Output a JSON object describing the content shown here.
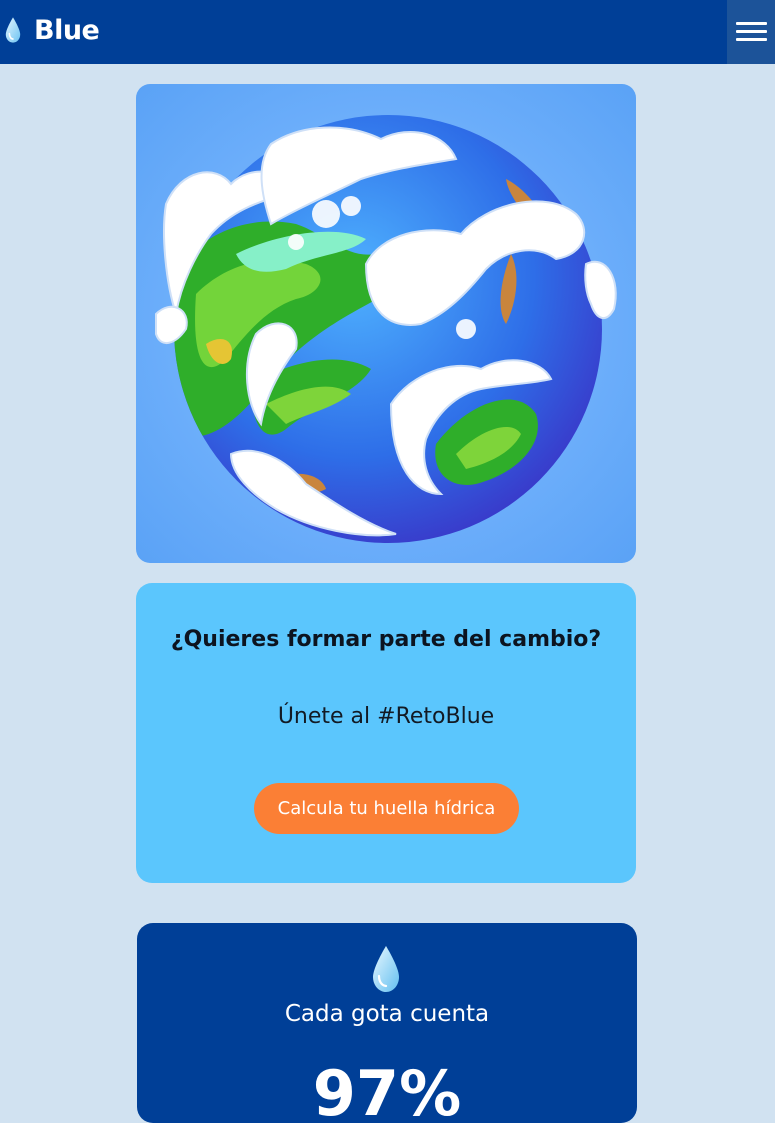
{
  "navbar": {
    "brand": "Blue",
    "logo_icon": "water-drop-icon",
    "menu_icon": "hamburger-menu-icon"
  },
  "hero": {
    "image": "cartoon-earth-globe-illustration"
  },
  "cta": {
    "title": "¿Quieres formar parte del cambio?",
    "subtitle": "Únete al #RetoBlue",
    "button": "Calcula tu huella hídrica"
  },
  "stat": {
    "icon": "water-drop-icon",
    "caption": "Cada gota cuenta",
    "value": "97%"
  },
  "colors": {
    "navbar": "#003f97",
    "background": "#d1e2f1",
    "cta_card": "#5bc6fd",
    "cta_button": "#fb7f35",
    "stat_card": "#003f97"
  }
}
